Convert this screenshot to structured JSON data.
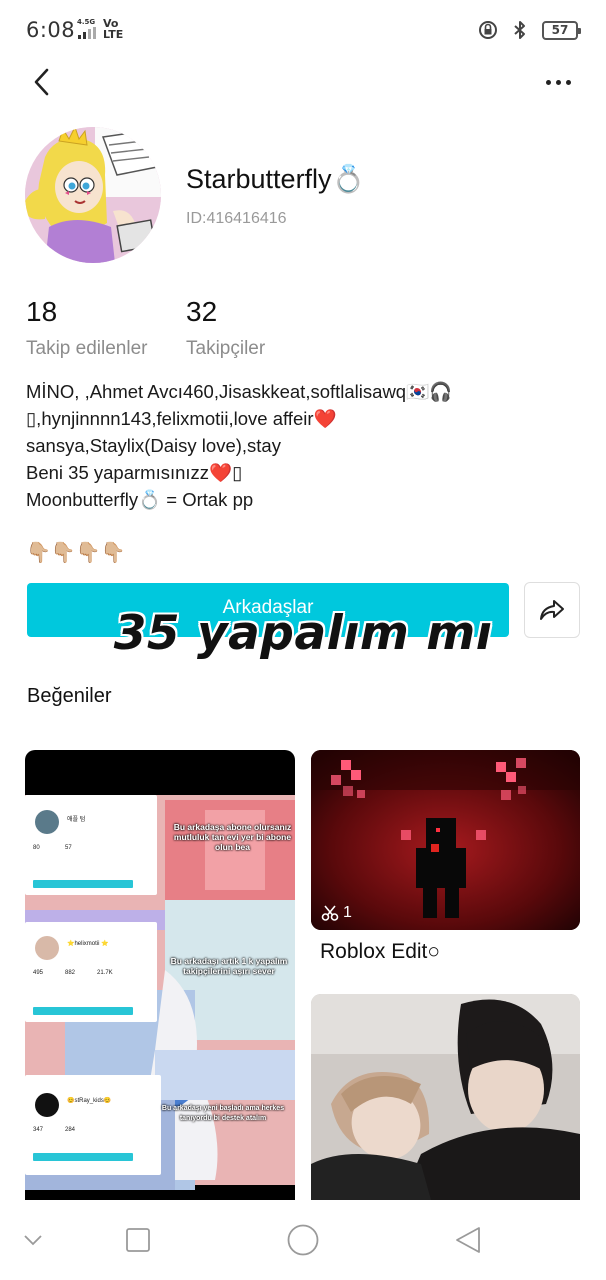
{
  "status_bar": {
    "time": "6:08",
    "network": "4.5G",
    "volte": [
      "Vo",
      "LTE"
    ],
    "battery": "57"
  },
  "nav": {
    "back_icon": "chevron-left-icon",
    "more_icon": "more-horizontal-icon"
  },
  "profile": {
    "username": "Starbutterfly💍",
    "user_id": "ID:416416416",
    "following_count": "18",
    "following_label": "Takip edilenler",
    "followers_count": "32",
    "followers_label": "Takipçiler",
    "bio_lines": [
      "MİNO, ,Ahmet Avcı460,Jisaskkeat,softlalisawq🇰🇷🎧",
      "▯,hynjinnnn143,felixmotii,love affeir❤️",
      "sansya,Staylix(Daisy love),stay",
      "Beni 35 yaparmısınızz❤️▯",
      "Moonbutterfly💍 = Ortak pp"
    ],
    "hands": "👇🏼👇🏼👇🏼👇🏼"
  },
  "actions": {
    "friends_label": "Arkadaşlar",
    "share_icon": "share-icon",
    "overlay_text": "35 yapalım mı"
  },
  "likes": {
    "title": "Beğeniler",
    "items": [
      {
        "thumb": {
          "mini_profiles": [
            {
              "name": "애플 텀",
              "stat1": "80",
              "stat2": "57"
            },
            {
              "name": "⭐helixmotii ⭐",
              "stat1": "495",
              "stat2": "882",
              "stat3": "21.7K"
            },
            {
              "name": "😊stRay_kids😊",
              "stat1": "347",
              "stat2": "284"
            }
          ],
          "overlay_captions": [
            "Bu arkadaşa abone olursanız mutluluk tan evi yer bi abone olun bea",
            "Bu arkadaşı artık 1 k yapalım takipçilerini aşırı sever",
            "Bu arkadaşı yeni başladı ama herkes tanıyordu bi destek atalım"
          ]
        }
      },
      {
        "clip_count": "1",
        "clip_icon": "scissors-icon",
        "caption": "Roblox Edit○"
      },
      {}
    ]
  },
  "system_nav": {
    "icons": [
      "chevron-down-icon",
      "recent-apps-icon",
      "home-icon",
      "back-triangle-icon"
    ]
  }
}
